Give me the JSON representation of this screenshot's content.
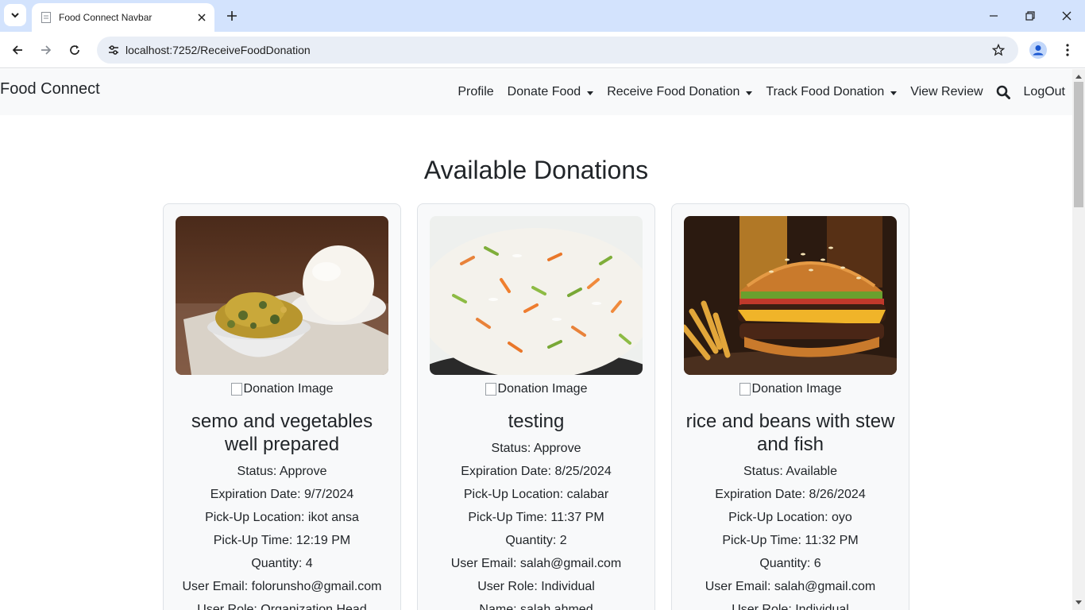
{
  "browser": {
    "tab_title": "Food Connect Navbar",
    "url": "localhost:7252/ReceiveFoodDonation"
  },
  "navbar": {
    "brand": "Food Connect",
    "links": {
      "profile": "Profile",
      "donate": "Donate Food",
      "receive": "Receive Food Donation",
      "track": "Track Food Donation",
      "review": "View Review",
      "logout": "LogOut"
    }
  },
  "main": {
    "title": "Available Donations",
    "image_alt": "Donation Image",
    "cards": [
      {
        "title": "semo and vegetables well prepared",
        "status": "Status: Approve",
        "expiration": "Expiration Date: 9/7/2024",
        "location": "Pick-Up Location: ikot ansa",
        "time": "Pick-Up Time: 12:19 PM",
        "quantity": "Quantity: 4",
        "email": "User Email: folorunsho@gmail.com",
        "role": "User Role: Organization Head"
      },
      {
        "title": "testing",
        "status": "Status: Approve",
        "expiration": "Expiration Date: 8/25/2024",
        "location": "Pick-Up Location: calabar",
        "time": "Pick-Up Time: 11:37 PM",
        "quantity": "Quantity: 2",
        "email": "User Email: salah@gmail.com",
        "role": "User Role: Individual",
        "extra": "Name: salah ahmed"
      },
      {
        "title": "rice and beans with stew and fish",
        "status": "Status: Available",
        "expiration": "Expiration Date: 8/26/2024",
        "location": "Pick-Up Location: oyo",
        "time": "Pick-Up Time: 11:32 PM",
        "quantity": "Quantity: 6",
        "email": "User Email: salah@gmail.com",
        "role": "User Role: Individual"
      }
    ]
  }
}
